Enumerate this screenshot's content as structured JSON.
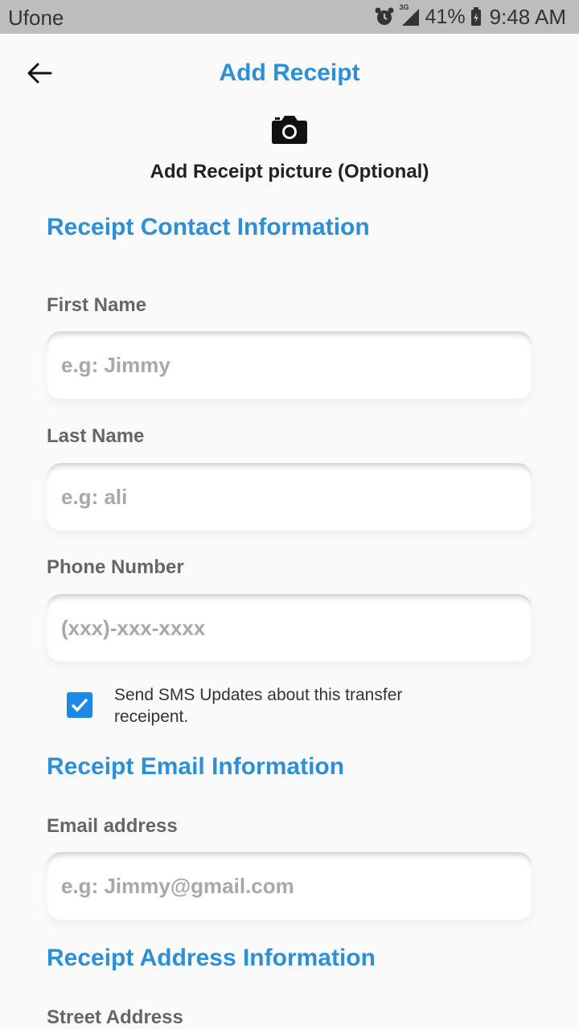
{
  "status_bar": {
    "carrier": "Ufone",
    "network": "3G",
    "battery": "41%",
    "time": "9:48 AM"
  },
  "header": {
    "title": "Add Receipt"
  },
  "picture": {
    "label": "Add Receipt picture (Optional)"
  },
  "contact_section": {
    "title": "Receipt Contact Information",
    "first_name": {
      "label": "First Name",
      "placeholder": "e.g: Jimmy",
      "value": ""
    },
    "last_name": {
      "label": "Last Name",
      "placeholder": "e.g: ali",
      "value": ""
    },
    "phone": {
      "label": "Phone Number",
      "placeholder": "(xxx)-xxx-xxxx",
      "value": ""
    },
    "sms": {
      "label": "Send SMS Updates about this transfer receipent.",
      "checked": true
    }
  },
  "email_section": {
    "title": "Receipt Email Information",
    "email": {
      "label": "Email address",
      "placeholder": "e.g: Jimmy@gmail.com",
      "value": ""
    }
  },
  "address_section": {
    "title": "Receipt Address Information",
    "street": {
      "label": "Street Address"
    }
  },
  "colors": {
    "accent": "#2d8fd6",
    "checkbox": "#1e88e5",
    "status_bar": "#bdbdbd"
  }
}
